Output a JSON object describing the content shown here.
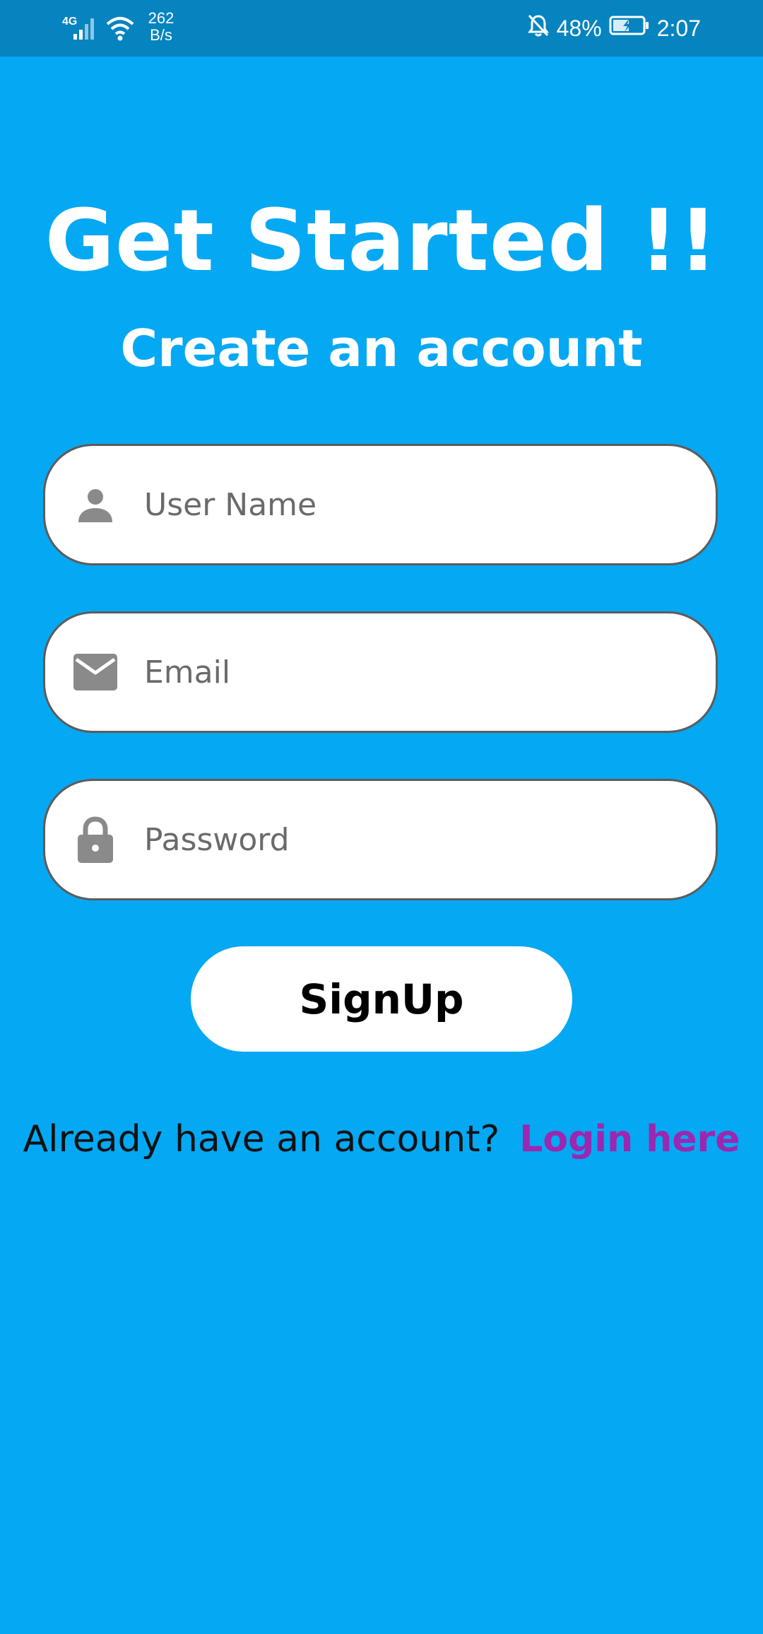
{
  "status_bar": {
    "network_type": "4G",
    "net_speed_value": "262",
    "net_speed_unit": "B/s",
    "battery_percent": "48%",
    "time": "2:07"
  },
  "header": {
    "title": "Get Started !!",
    "subtitle": "Create an account"
  },
  "form": {
    "username_placeholder": "User Name",
    "email_placeholder": "Email",
    "password_placeholder": "Password",
    "signup_label": "SignUp"
  },
  "footer": {
    "prompt": "Already have an account?",
    "login_link": "Login here"
  },
  "icons": {
    "username": "person-icon",
    "email": "envelope-icon",
    "password": "lock-icon"
  },
  "colors": {
    "background": "#05a8f3",
    "status_bar": "#0584c0",
    "login_link": "#9c27b0",
    "icon_gray": "#8a8a8a"
  }
}
